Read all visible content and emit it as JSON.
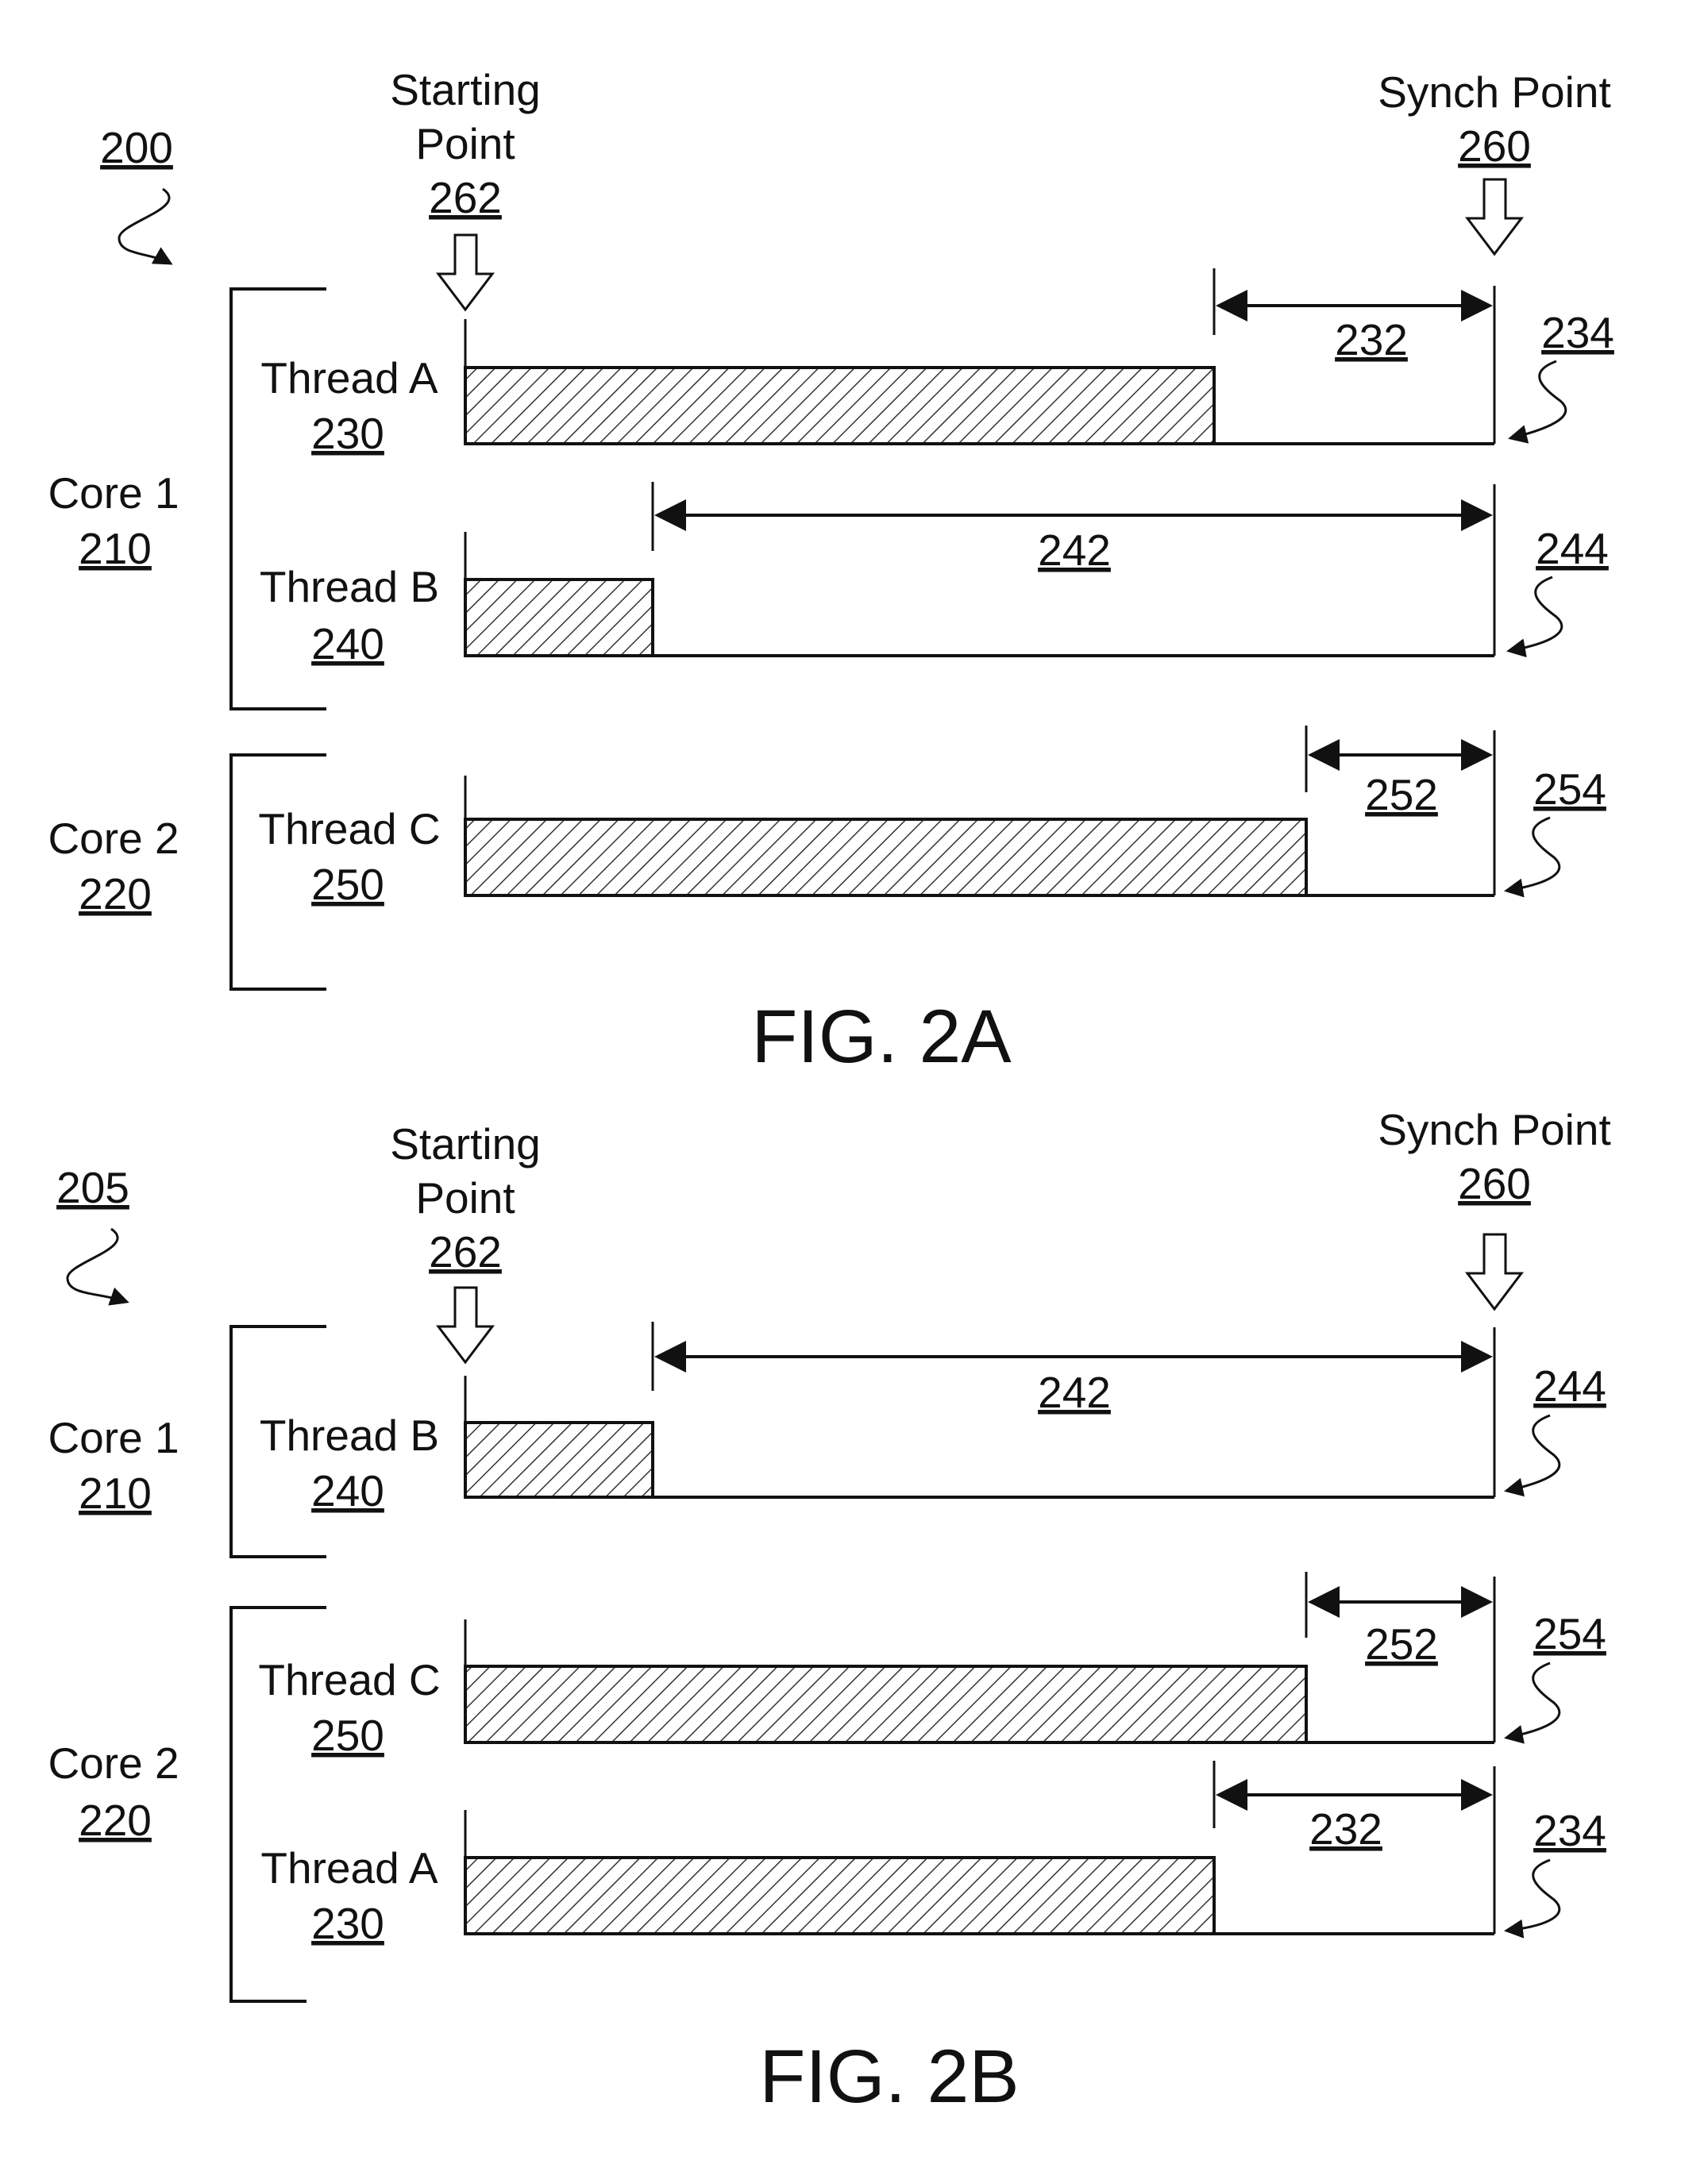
{
  "figures": [
    {
      "id": "fig2a",
      "caption": "FIG. 2A",
      "ref": "200",
      "starting_point": {
        "label_line1": "Starting",
        "label_line2": "Point",
        "ref": "262"
      },
      "synch_point": {
        "label": "Synch Point",
        "ref": "260"
      },
      "cores": [
        {
          "label": "Core 1",
          "ref": "210",
          "threads": [
            {
              "label": "Thread A",
              "ref": "230",
              "work_fraction": 0.729,
              "wait_ref": "232",
              "arrow_ref": "234"
            },
            {
              "label": "Thread B",
              "ref": "240",
              "work_fraction": 0.182,
              "wait_ref": "242",
              "arrow_ref": "244"
            }
          ]
        },
        {
          "label": "Core 2",
          "ref": "220",
          "threads": [
            {
              "label": "Thread C",
              "ref": "250",
              "work_fraction": 0.817,
              "wait_ref": "252",
              "arrow_ref": "254"
            }
          ]
        }
      ]
    },
    {
      "id": "fig2b",
      "caption": "FIG. 2B",
      "ref": "205",
      "starting_point": {
        "label_line1": "Starting",
        "label_line2": "Point",
        "ref": "262"
      },
      "synch_point": {
        "label": "Synch Point",
        "ref": "260"
      },
      "cores": [
        {
          "label": "Core 1",
          "ref": "210",
          "threads": [
            {
              "label": "Thread B",
              "ref": "240",
              "work_fraction": 0.182,
              "wait_ref": "242",
              "arrow_ref": "244"
            }
          ]
        },
        {
          "label": "Core 2",
          "ref": "220",
          "threads": [
            {
              "label": "Thread C",
              "ref": "250",
              "work_fraction": 0.817,
              "wait_ref": "252",
              "arrow_ref": "254"
            },
            {
              "label": "Thread A",
              "ref": "230",
              "work_fraction": 0.729,
              "wait_ref": "232",
              "arrow_ref": "234"
            }
          ]
        }
      ]
    }
  ]
}
